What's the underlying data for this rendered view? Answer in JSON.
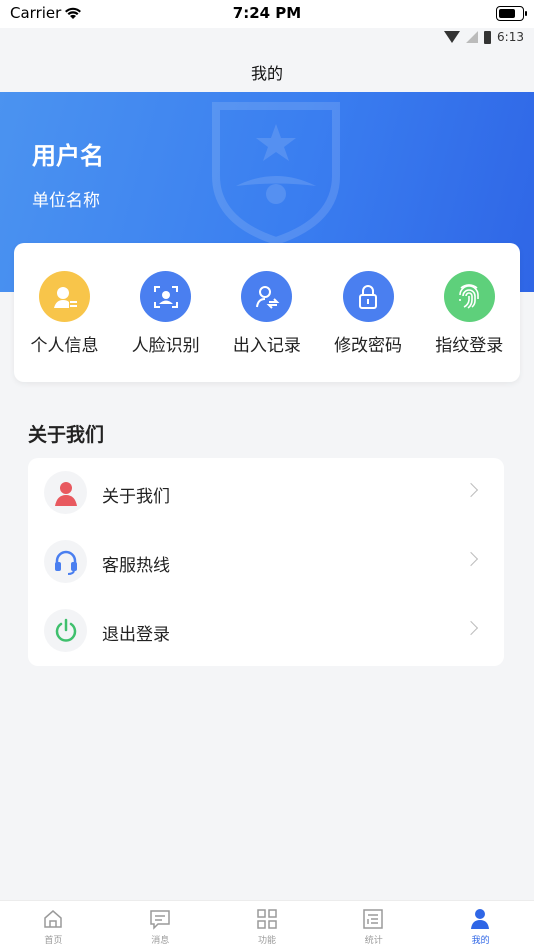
{
  "ios_status": {
    "carrier": "Carrier",
    "time": "7:24 PM",
    "battery_level": 0.75
  },
  "android_status": {
    "time": "6:13",
    "icons": [
      "wifi-icon",
      "no-signal-icon",
      "battery-icon"
    ]
  },
  "nav": {
    "title": "我的"
  },
  "profile": {
    "username": "用户名",
    "unit": "单位名称",
    "banner_color": "#3a7ef0"
  },
  "quick_actions": [
    {
      "label": "个人信息",
      "icon": "person-info-icon",
      "color": "#f8c54a"
    },
    {
      "label": "人脸识别",
      "icon": "face-scan-icon",
      "color": "#4a7ff0"
    },
    {
      "label": "出入记录",
      "icon": "access-record-icon",
      "color": "#4a7ff0"
    },
    {
      "label": "修改密码",
      "icon": "lock-icon",
      "color": "#4a7ff0"
    },
    {
      "label": "指纹登录",
      "icon": "fingerprint-icon",
      "color": "#5ed07b"
    }
  ],
  "section": {
    "title": "关于我们"
  },
  "menu": [
    {
      "label": "关于我们",
      "icon": "person-icon",
      "color": "#e8595f"
    },
    {
      "label": "客服热线",
      "icon": "headset-icon",
      "color": "#4a7ff0"
    },
    {
      "label": "退出登录",
      "icon": "power-icon",
      "color": "#3fc06d"
    }
  ],
  "tabs": [
    {
      "label": "首页",
      "icon": "home-icon",
      "active": false
    },
    {
      "label": "消息",
      "icon": "message-icon",
      "active": false
    },
    {
      "label": "功能",
      "icon": "grid-icon",
      "active": false
    },
    {
      "label": "统计",
      "icon": "statistics-icon",
      "active": false
    },
    {
      "label": "我的",
      "icon": "profile-icon",
      "active": true
    }
  ],
  "colors": {
    "accent": "#2f66e6",
    "background": "#f4f5f7"
  }
}
